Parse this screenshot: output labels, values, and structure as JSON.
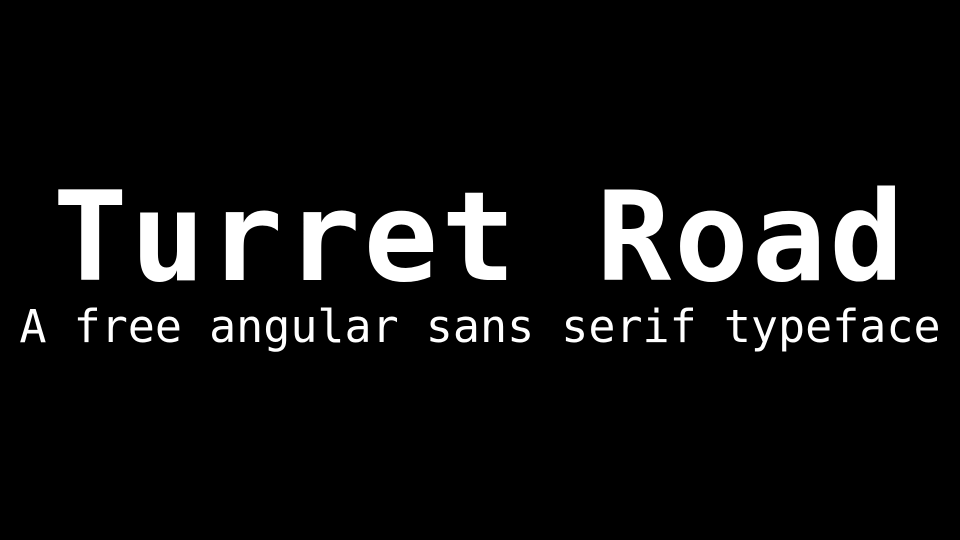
{
  "title": "Turret Road",
  "subtitle": "A free angular sans serif typeface",
  "colors": {
    "background": "#000000",
    "text": "#ffffff"
  }
}
